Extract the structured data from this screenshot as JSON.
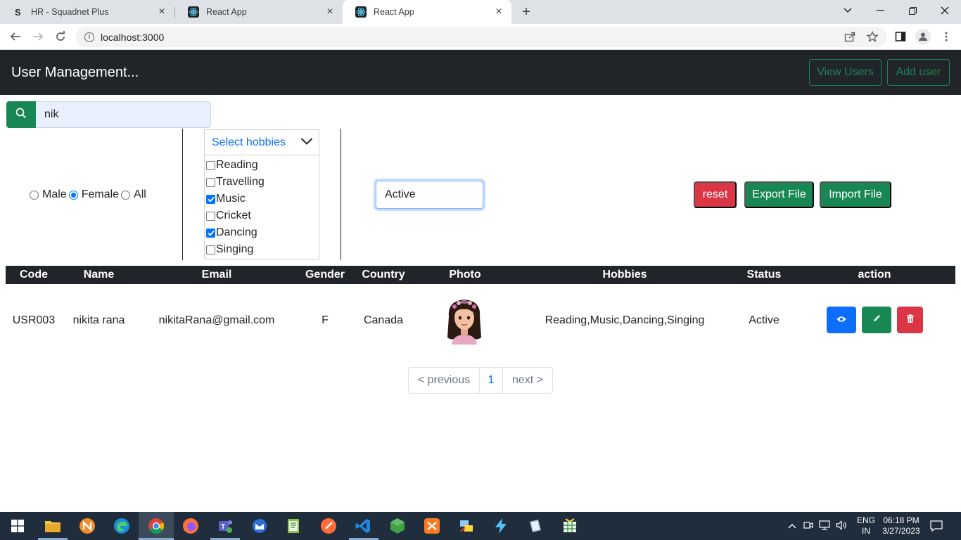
{
  "browser": {
    "tabs": [
      {
        "title": "HR - Squadnet Plus",
        "active": false
      },
      {
        "title": "React App",
        "active": false
      },
      {
        "title": "React App",
        "active": true
      }
    ],
    "url": "localhost:3000"
  },
  "header": {
    "brand": "User Management...",
    "view_users": "View Users",
    "add_user": "Add user"
  },
  "search": {
    "value": "nik"
  },
  "filters": {
    "gender_options": [
      {
        "label": "Male",
        "checked": false
      },
      {
        "label": "Female",
        "checked": true
      },
      {
        "label": "All",
        "checked": false
      }
    ],
    "hobbies_placeholder": "Select hobbies",
    "hobbies": [
      {
        "label": "Reading",
        "checked": false
      },
      {
        "label": "Travelling",
        "checked": false
      },
      {
        "label": "Music",
        "checked": true
      },
      {
        "label": "Cricket",
        "checked": false
      },
      {
        "label": "Dancing",
        "checked": true
      },
      {
        "label": "Singing",
        "checked": false
      }
    ],
    "status_value": "Active"
  },
  "actions": {
    "reset": "reset",
    "export": "Export File",
    "import": "Import File"
  },
  "table": {
    "headers": [
      "Code",
      "Name",
      "Email",
      "Gender",
      "Country",
      "Photo",
      "Hobbies",
      "Status",
      "action"
    ],
    "rows": [
      {
        "code": "USR003",
        "name": "nikita rana",
        "email": "nikitaRana@gmail.com",
        "gender": "F",
        "country": "Canada",
        "photo": "avatar-image",
        "hobbies": "Reading,Music,Dancing,Singing",
        "status": "Active"
      }
    ]
  },
  "pagination": {
    "previous": "< previous",
    "current": "1",
    "next": "next >"
  },
  "taskbar": {
    "language": "ENG",
    "region": "IN",
    "time": "06:18 PM",
    "date": "3/27/2023"
  },
  "colors": {
    "dark": "#212529",
    "success": "#198754",
    "primary": "#0d6efd",
    "danger": "#dc3545"
  }
}
